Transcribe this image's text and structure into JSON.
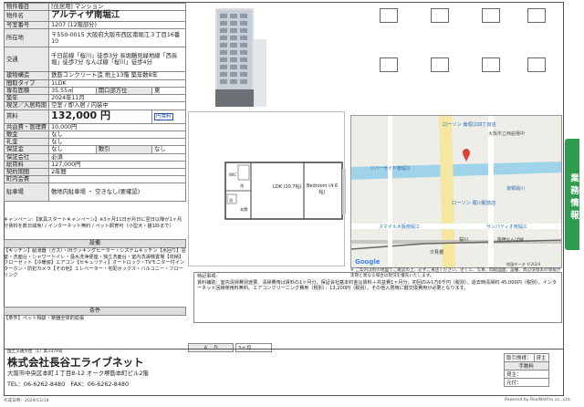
{
  "spec": {
    "rows": [
      {
        "label": "物件種目",
        "value": "[住居用] マンション"
      },
      {
        "label": "物件名",
        "value": "アルティザ南堀江"
      },
      {
        "label": "号室番号",
        "value": "1207 (12階部分)"
      },
      {
        "label": "所在地",
        "value": "〒550-0015 大阪府大阪市西区南堀江３丁目16番10"
      },
      {
        "label": "交通",
        "value": "千日前線「桜川」徒歩3分 長堀鶴見緑地線「西長堀」徒歩7分 なんば線「桜川」徒歩4分"
      },
      {
        "label": "建物構造",
        "value": "鉄筋コンクリート造 地上13階 築年数8年"
      },
      {
        "label": "間取タイプ",
        "value": "1LDK"
      },
      {
        "label": "専有面積",
        "value": "35.55㎡",
        "extra_label": "開口部方位",
        "extra_value": "東"
      },
      {
        "label": "築年",
        "value": "2024年11月"
      },
      {
        "label": "現況／入居時期",
        "value": "空室 / 即入居 / 内装中"
      },
      {
        "label": "賃料",
        "value": "132,000 円",
        "badge": "円賃料"
      },
      {
        "label": "共益費・管理費",
        "value": "10,000円"
      },
      {
        "label": "敷金",
        "value": "なし"
      },
      {
        "label": "礼金",
        "value": "なし"
      },
      {
        "label": "保証金",
        "value": "なし",
        "extra_label": "敷引",
        "extra_value": "なし"
      },
      {
        "label": "保証会社",
        "value": "必須"
      },
      {
        "label": "総賃料",
        "value": "127,000円"
      },
      {
        "label": "契約期間",
        "value": "2年間"
      },
      {
        "label": "町内会費",
        "value": ""
      },
      {
        "label": "駐車場",
        "value": "敷地内駐車場 ・ 空きなし(要確認)"
      }
    ]
  },
  "photo": {
    "alt": "建物外観"
  },
  "thumbnails": [
    "",
    "",
    "",
    "",
    "",
    "",
    "",
    ""
  ],
  "floorplan": {
    "room1": "LDK (10.7帖)",
    "room2": "Bedroom (4.6帖)",
    "labels": [
      "WIC",
      "洗",
      "浴",
      "玄関"
    ]
  },
  "map": {
    "labels": [
      "ローソン 南堀江四丁目店",
      "大阪市立西船場中",
      "リバーサイド南堀江",
      "道頓堀川",
      "ローソン 堀川駅前店",
      "サンパティオ南堀江",
      "スマイル大阪南堀江",
      "阪神なんば線",
      "桜川",
      "汐見橋"
    ],
    "copyright": "地図データ ©2024",
    "google": "Google"
  },
  "map_note": "※ ご案内は別の地図でご確認の上、必ずご来店ください。近くに、写真、間取図面、設備、周辺環境等の情報が実際と異なる場合は現況を優先いたします。",
  "notes": {
    "campaign": "キャンペーン:【家具スタートキャンペーン】※3ヶ月11日が月日に翌日以降が1ヶ月分賃料を数日減免! / インターネット無料 / ペット飼育可（小型犬・猫1匹まで）",
    "facility_head": "設備",
    "facilities": "【キッチン】給湯器（ガス）・IHクッキングヒーター・システムキッチン【水回り】浴室・洗面台・シャワートイレ・温水洗浄便座・独立洗面台・室内洗濯機置場【収納】クローゼット【冷暖房】エアコン【セキュリティ】オートロック・TVモニター付インターホン・防犯カメラ【その他】エレベーター・宅配ボックス・バルコニー・フローリング",
    "condition_head": "条件",
    "conditions": "【条件】ペット相談・楽器全体的拡張"
  },
  "remarks": {
    "title": "特記事項:",
    "body": "賃料補助：室内清掃費別途要、清掃費用は賃料の1ヶ月分。保証会社基本料金は賃料＋共益費1ヶ月分。初回のみ1万6千円（税別）。退去時清掃料 45,000円（税別）。インターネット回線使用料無料。エアコンクリーニング費用（税別）：13,200円（税別）。その他入居時に鍵交換費用が必要となります。"
  },
  "ad": {
    "label": "Ａ　Ｄ",
    "value": "3ヶ月"
  },
  "footer": {
    "license": "国土交通大臣（1）第3379号",
    "company": "株式会社長谷工ライブネット",
    "address": "大阪市中央区本町１丁目8-12 オーク堺筋本町ビル2階",
    "tel": "TEL：06-6262-8480　FAX：06-6262-8480",
    "conditions": [
      {
        "label": "取引態様：",
        "value": "貸主"
      },
      {
        "label": "手数料",
        "value": ""
      },
      {
        "label": "貸主：",
        "value": "0%  借主：100%"
      },
      {
        "label": "元付：",
        "value": "0%  客付：100%"
      }
    ]
  },
  "meta": {
    "created": "作成日時：2024/12/18",
    "powered": "Powered by RealNetPro co., Ltd."
  },
  "side_tab": "業務情報"
}
